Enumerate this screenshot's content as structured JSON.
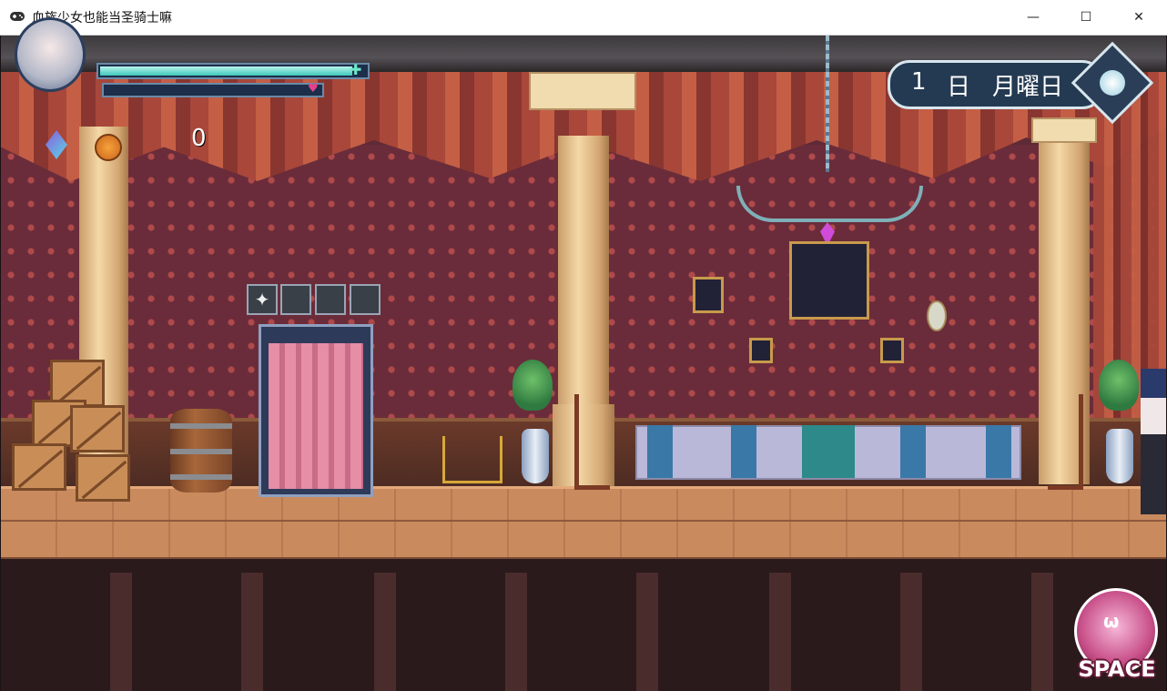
{
  "window": {
    "title": "血族少女也能当圣骑士嘛",
    "icon": "gamepad-icon",
    "minimize_label": "—",
    "maximize_label": "☐",
    "close_label": "✕"
  },
  "hud": {
    "coin_count": "0",
    "hp_fraction": 0.95,
    "mp_fraction": 0.0,
    "hp_icon": "plus-icon",
    "mp_icon": "heart-icon"
  },
  "calendar": {
    "day_number": "1",
    "day_unit": "日",
    "weekday": "月曜日",
    "icon": "moon-icon"
  },
  "inventory": {
    "slots": [
      {
        "icon": "moth-icon",
        "filled": true
      },
      {
        "icon": "",
        "filled": false
      },
      {
        "icon": "",
        "filled": false
      },
      {
        "icon": "",
        "filled": false
      }
    ]
  },
  "action_button": {
    "label": "SPACE",
    "face": "ω",
    "icon": "backpack-icon"
  },
  "colors": {
    "hp": "#3ec7b8",
    "mp": "#e8408a",
    "panel": "#243a52",
    "accent": "#c8508a"
  }
}
